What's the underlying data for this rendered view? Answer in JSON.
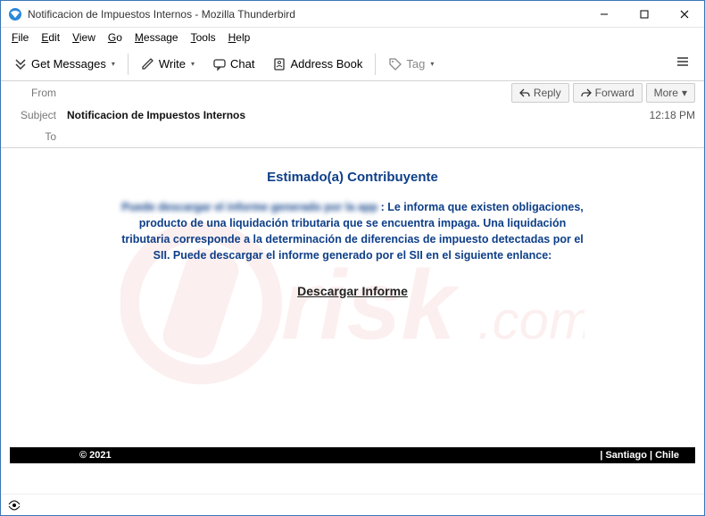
{
  "window": {
    "title": "Notificacion de Impuestos Internos - Mozilla Thunderbird"
  },
  "menu": {
    "file": "File",
    "edit": "Edit",
    "view": "View",
    "go": "Go",
    "message": "Message",
    "tools": "Tools",
    "help": "Help"
  },
  "toolbar": {
    "get_messages": "Get Messages",
    "write": "Write",
    "chat": "Chat",
    "address_book": "Address Book",
    "tag": "Tag"
  },
  "header": {
    "from_lbl": "From",
    "from_val": "",
    "subject_lbl": "Subject",
    "subject_val": "Notificacion de Impuestos Internos",
    "to_lbl": "To",
    "to_val": "",
    "reply": "Reply",
    "forward": "Forward",
    "more": "More",
    "time": "12:18 PM"
  },
  "message": {
    "greeting": "Estimado(a) Contribuyente",
    "blurred": "Puede descargar el informe generado por la app",
    "body_rest": " : Le informa que existen obligaciones, producto de una liquidación tributaria que se encuentra impaga. Una liquidación tributaria corresponde a la determinación de diferencias de impuesto detectadas por el SII.   Puede descargar el informe generado por el SII en el siguiente enlance:",
    "link": "Descargar Informe",
    "footer_left": "© 2021",
    "footer_right": "| Santiago | Chile"
  }
}
